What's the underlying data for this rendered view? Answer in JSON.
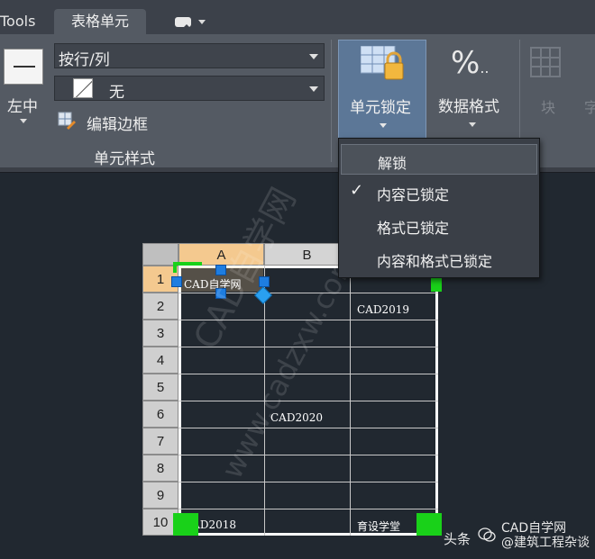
{
  "ribbon": {
    "tabs": {
      "tools": "Tools",
      "active": "表格单元"
    },
    "alignment_label": "左中",
    "row_col_dropdown": "按行/列",
    "border_dropdown": "无",
    "edit_borders": "编辑边框",
    "group_label": "单元样式",
    "cell_lock_label": "单元锁定",
    "data_format_label": "数据格式",
    "data_format_glyph": "%",
    "data_format_dots": "..",
    "block_label": "块",
    "field_label": "字",
    "colors": {
      "lock_active_bg": "#5c7797",
      "ribbon_bg": "#545a63"
    }
  },
  "lock_menu": {
    "items": [
      {
        "label": "解锁",
        "checked": false,
        "highlighted": true
      },
      {
        "label": "内容已锁定",
        "checked": true,
        "highlighted": false
      },
      {
        "label": "格式已锁定",
        "checked": false,
        "highlighted": false
      },
      {
        "label": "内容和格式已锁定",
        "checked": false,
        "highlighted": false
      }
    ],
    "check_glyph": "✓"
  },
  "table": {
    "column_headers": [
      "A",
      "B"
    ],
    "row_headers": [
      "1",
      "2",
      "3",
      "4",
      "5",
      "6",
      "7",
      "8",
      "9",
      "10"
    ],
    "cells": {
      "a1": "CAD自学网",
      "c2": "CAD2019",
      "b6": "CAD2020",
      "a10": "CAD2018",
      "c10": "育设学堂"
    },
    "selected_cell": "A1",
    "colors": {
      "header_selected": "#f4c98f",
      "grip_blue": "#1e7de0",
      "grip_green": "#19d119"
    }
  },
  "watermark": {
    "line1": "CAD自学网",
    "line2": "www.cadzxw.com"
  },
  "credit": {
    "prefix": "头条",
    "name": "CAD自学网",
    "sub": "@建筑工程杂谈"
  }
}
